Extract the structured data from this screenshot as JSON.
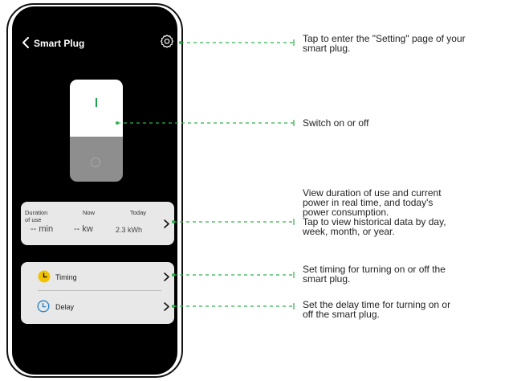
{
  "header": {
    "title": "Smart Plug"
  },
  "stats": {
    "duration_label_line1": "Duration",
    "duration_label_line2": "of use",
    "now_label": "Now",
    "today_label": "Today",
    "duration_value": "-- min",
    "now_value": "-- kw",
    "today_value": "2.3 kWh"
  },
  "actions": {
    "timing_label": "Timing",
    "delay_label": "Delay"
  },
  "annotations": {
    "settings": [
      "Tap to enter the \"Setting\" page of your",
      "smart plug."
    ],
    "switch": [
      "Switch on or off"
    ],
    "stats": [
      "View duration of use and current",
      "power in real time, and today's",
      "power consumption.",
      "Tap to view historical data by day,",
      "week, month, or year."
    ],
    "timing": [
      "Set timing for turning on or off the",
      "smart plug."
    ],
    "delay": [
      "Set the delay time for turning on or",
      "off the smart plug."
    ]
  },
  "colors": {
    "annotation_green": "#2db34a",
    "switch_on_green": "#1aa34a",
    "timing_icon_yellow": "#f2c200",
    "delay_icon_blue": "#2b84c8"
  },
  "icons": [
    "chevron-left-icon",
    "gear-icon",
    "chevron-right-icon",
    "clock-icon",
    "timer-icon"
  ]
}
